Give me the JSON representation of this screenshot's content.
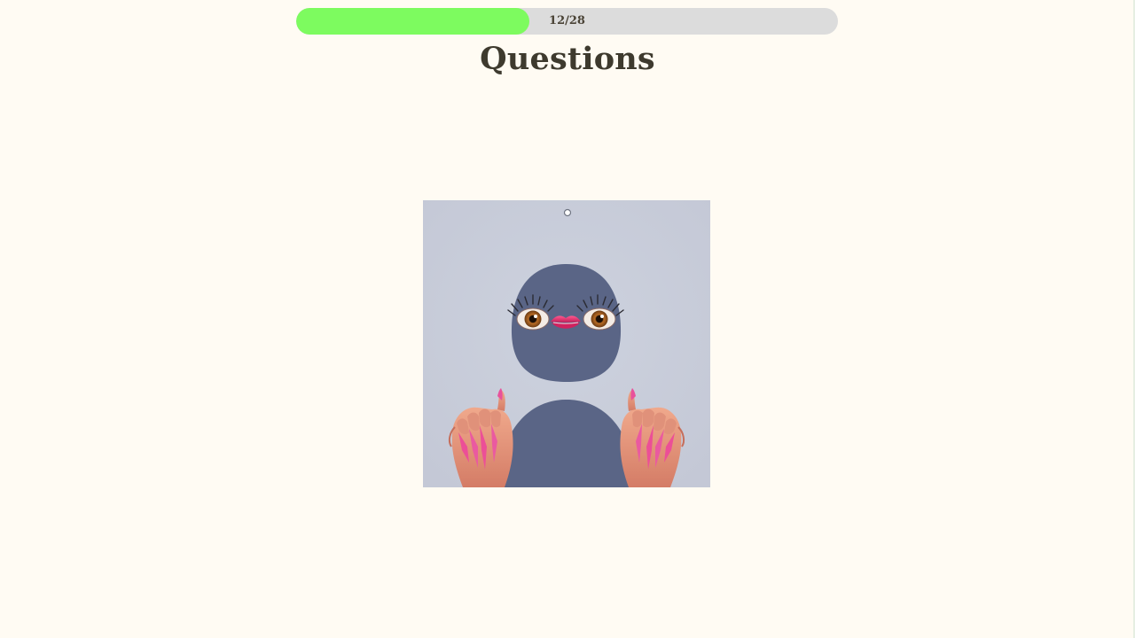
{
  "progress": {
    "text": "12/28",
    "current": 12,
    "total": 28,
    "fraction": 0.43,
    "fill_color": "#7dfb5f",
    "track_color": "#dcdcdc"
  },
  "page": {
    "title": "Questions",
    "background": "#fffbf3"
  },
  "question": {
    "image_icon": "creature-illustration"
  }
}
